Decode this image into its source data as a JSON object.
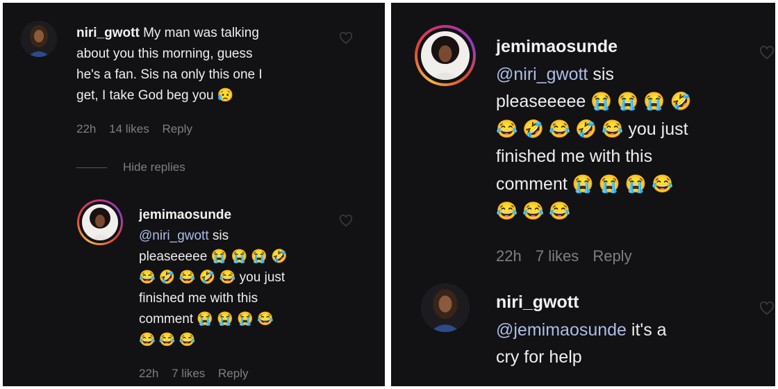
{
  "left": {
    "comment": {
      "username": "niri_gwott",
      "text_lines": [
        "My man was talking",
        "about you this morning, guess",
        "he's a fan. Sis na only this one I",
        "get, I take God beg you"
      ],
      "emoji_end": "😥",
      "time": "22h",
      "likes": "14 likes",
      "reply": "Reply"
    },
    "hide_replies": "Hide replies",
    "reply": {
      "username": "jemimaosunde",
      "mention": "@niri_gwott",
      "line1_rest": " sis",
      "line2_text": "pleaseeeee",
      "line2_emojis": "😭 😭 😭 🤣",
      "line3_emojis": "😂 🤣 😂 🤣 😂",
      "line3_text": " you just",
      "line4_text": "finished me with this",
      "line5_text": "comment",
      "line5_emojis": "😭 😭 😭 😂",
      "line6_emojis": "😂 😂 😂",
      "time": "22h",
      "likes": "7 likes",
      "reply": "Reply"
    }
  },
  "right": {
    "comment": {
      "username": "jemimaosunde",
      "mention": "@niri_gwott",
      "line1_rest": " sis",
      "line2_text": "pleaseeeee",
      "line2_emojis": "😭 😭 😭 🤣",
      "line3_emojis": "😂 🤣 😂 🤣 😂",
      "line3_text": " you just",
      "line4_text": "finished me with this",
      "line5_text": "comment",
      "line5_emojis": "😭 😭 😭 😂",
      "line6_emojis": "😂 😂 😂",
      "time": "22h",
      "likes": "7 likes",
      "reply": "Reply"
    },
    "reply": {
      "username": "niri_gwott",
      "mention": "@jemimaosunde",
      "line1_rest": " it's a",
      "line2_text": "cry for help"
    }
  },
  "icons": {
    "like": "heart-outline-icon"
  },
  "colors": {
    "background": "#121214",
    "mention": "#aebde6",
    "meta": "#7f7f84",
    "ring": "#c72f84"
  }
}
